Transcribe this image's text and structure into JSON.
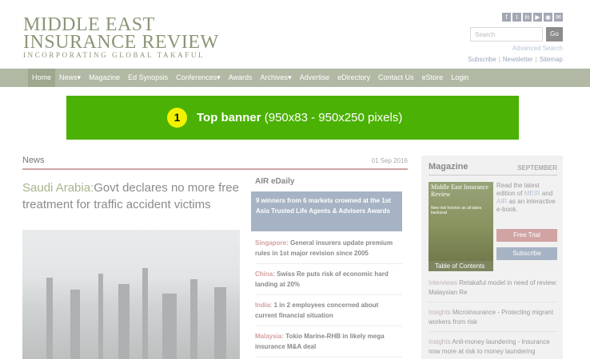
{
  "logo": {
    "line1": "MIDDLE EAST",
    "line2": "INSURANCE REVIEW",
    "tagline": "INCORPORATING GLOBAL TAKAFUL"
  },
  "social": [
    "facebook-icon",
    "twitter-icon",
    "linkedin-icon",
    "youtube-icon",
    "rss-icon",
    "email-icon"
  ],
  "search": {
    "placeholder": "Search",
    "go": "Go",
    "advanced": "Advanced Search"
  },
  "toplinks": [
    "Subscribe",
    "Newsletter",
    "Sitemap"
  ],
  "nav": [
    "Home",
    "News",
    "Magazine",
    "Ed Synopsis",
    "Conferences",
    "Awards",
    "Archives",
    "Advertise",
    "eDirectory",
    "Contact Us",
    "eStore",
    "Login"
  ],
  "banner": {
    "number": "1",
    "bold": "Top banner",
    "rest": "(950x83 - 950x250 pixels)"
  },
  "news": {
    "title": "News",
    "date": "01 Sep 2016",
    "country": "Saudi Arabia:",
    "headline": "Govt declares no more free treatment for traffic accident victims"
  },
  "air": {
    "title": "AIR eDaily",
    "top": "9 winners from 6 markets crowned at the 1st Asia Trusted Life Agents & Advisers Awards",
    "items": [
      {
        "country": "Singapore:",
        "text": "General insurers update premium rules in 1st major revision since 2005"
      },
      {
        "country": "China:",
        "text": "Swiss Re puts risk of economic hard landing at 20%"
      },
      {
        "country": "India:",
        "text": "1 in 2 employees concerned about current financial situation"
      },
      {
        "country": "Malaysia:",
        "text": "Tokio Marine-RHB in likely mega insurance M&A deal"
      }
    ]
  },
  "magazine": {
    "title": "Magazine",
    "month": "SEPTEMBER",
    "cover_title": "Middle East Insurance Review",
    "cover_sub": "New risk horizon as all takes backseat",
    "toc": "Table of Contents",
    "read1": "Read the latest edition of ",
    "meir": "MEIR",
    "and": " and ",
    "air": "AIR",
    "read2": " as an interactive e-book.",
    "trial": "Free Trial",
    "subscribe": "Subscribe",
    "list": [
      {
        "kind": "Interviews",
        "text": "Retakaful model in need of review: Malaysian Re"
      },
      {
        "kind": "Insights",
        "text": "Microinsurance - Protecting migrant workers from risk"
      },
      {
        "kind": "Insights",
        "text": "Anti-money laundering - Insurance now more at risk to money laundering"
      }
    ]
  }
}
